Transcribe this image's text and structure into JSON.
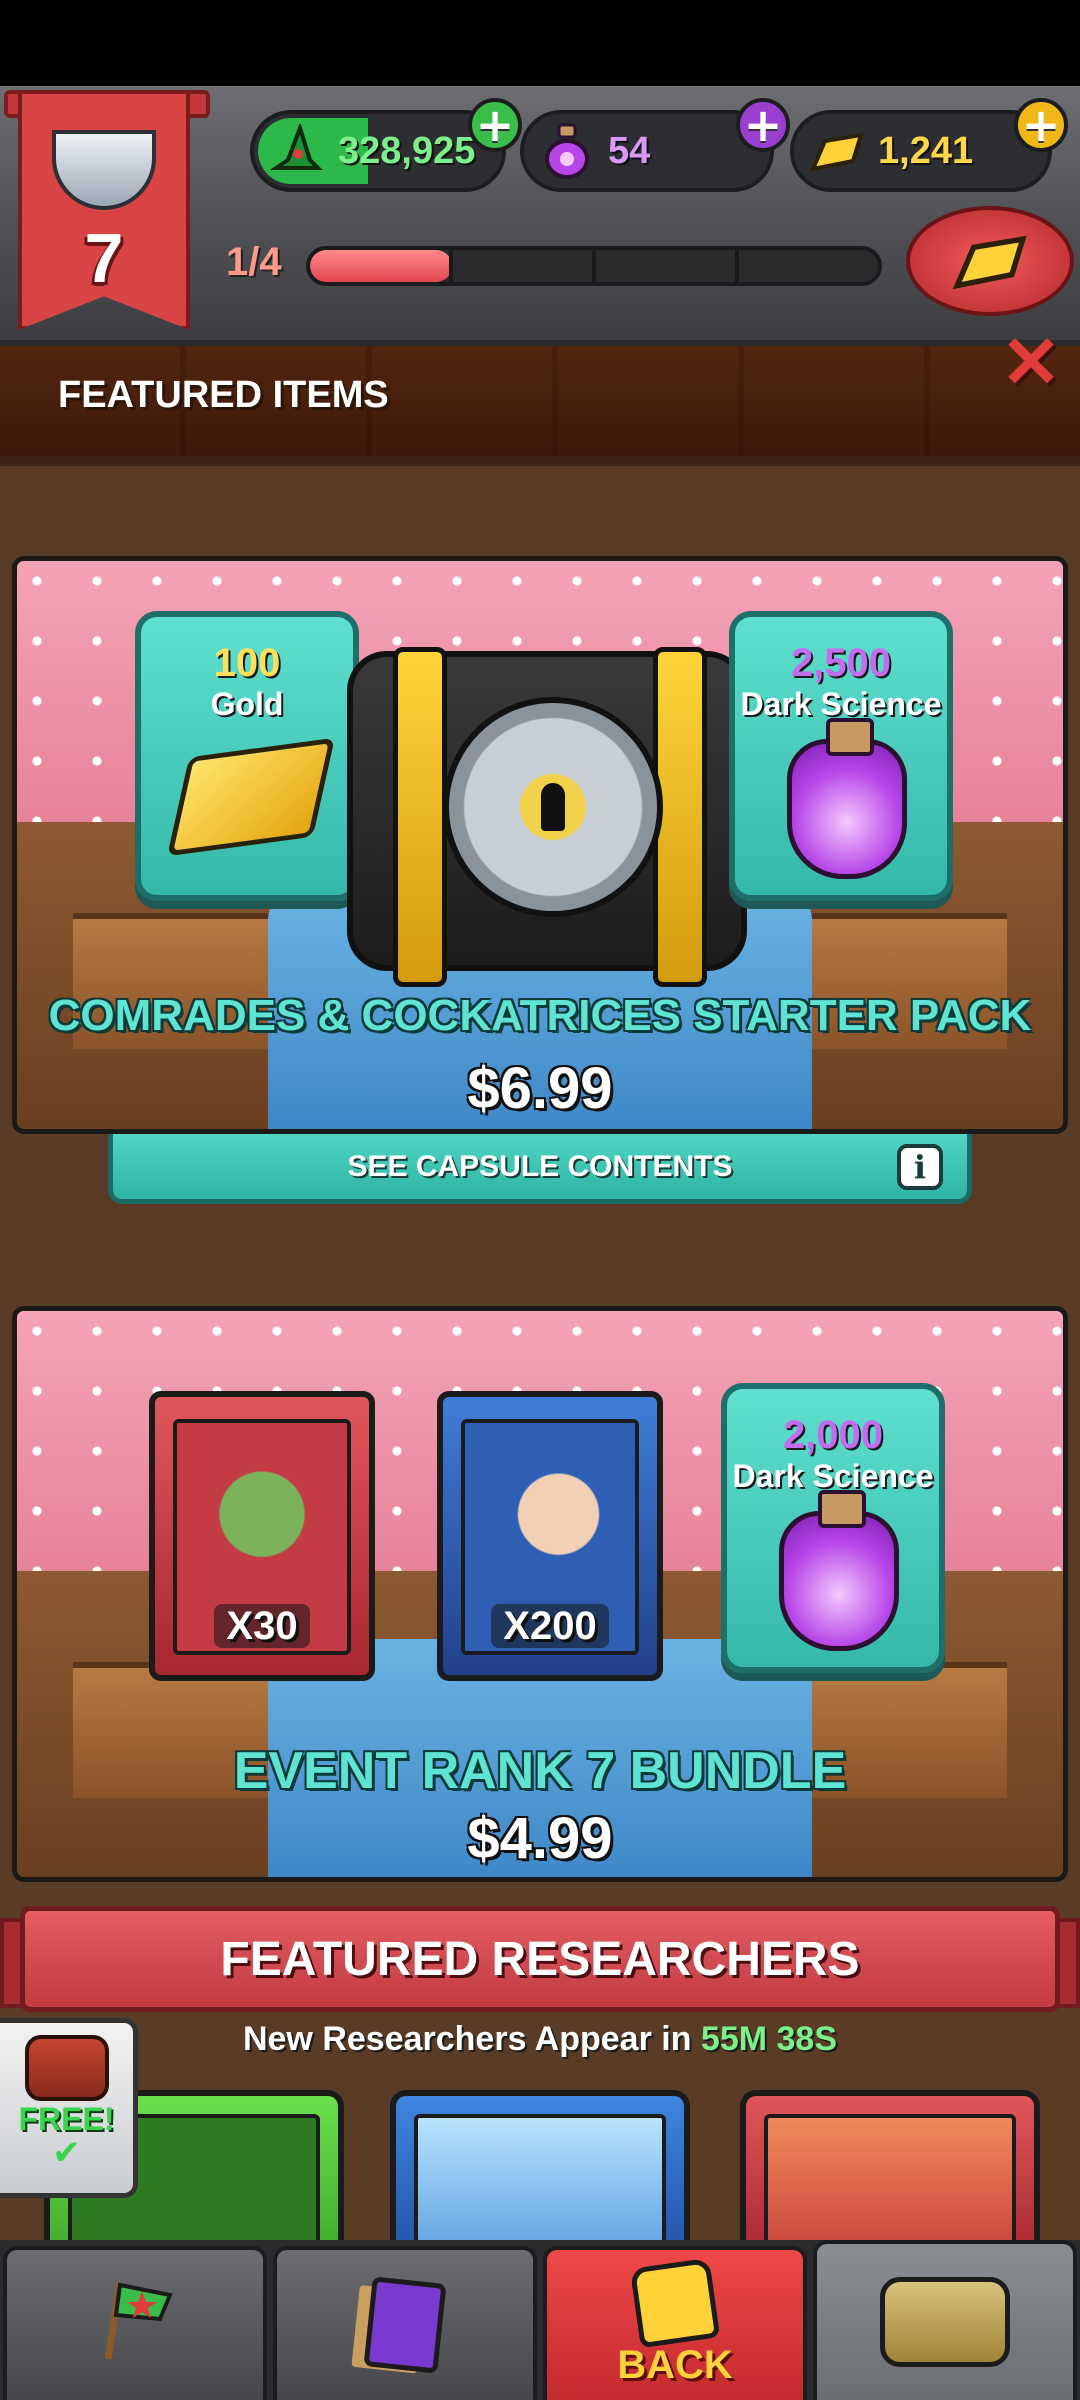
{
  "hud": {
    "rank": "7",
    "currencies": {
      "green": {
        "value": "328,925",
        "icon": "wizard-hat-icon",
        "color": "#2db84a"
      },
      "purple": {
        "value": "54",
        "icon": "dark-science-potion-icon",
        "color": "#9b3fd2"
      },
      "gold": {
        "value": "1,241",
        "icon": "gold-bar-icon",
        "color": "#f0b816"
      }
    },
    "progress": {
      "label": "1/4",
      "fraction": 0.25
    },
    "plus_symbol": "+",
    "close_symbol": "✕"
  },
  "featured": {
    "title": "FEATURED ITEMS",
    "offers": [
      {
        "tiles": [
          {
            "amount": "100",
            "name": "Gold",
            "icon": "gold-bar-icon"
          },
          {
            "amount": "2,500",
            "name": "Dark Science",
            "icon": "dark-science-potion-icon"
          }
        ],
        "centerpiece": "vault-capsule-icon",
        "name": "COMRADES & COCKATRICES STARTER PACK",
        "price": "$6.99",
        "capsule_button": "SEE CAPSULE CONTENTS",
        "info_symbol": "i"
      },
      {
        "cards": [
          {
            "count": "X30",
            "frame_color": "#d94545"
          },
          {
            "count": "X200",
            "frame_color": "#3f7ed8"
          }
        ],
        "tiles": [
          {
            "amount": "2,000",
            "name": "Dark Science",
            "icon": "dark-science-potion-icon"
          }
        ],
        "name": "EVENT RANK 7 BUNDLE",
        "price": "$4.99"
      }
    ]
  },
  "researchers": {
    "title": "FEATURED RESEARCHERS",
    "timer_prefix": "New Researchers Appear in",
    "timer_value": "55M 38S",
    "free_label": "FREE!"
  },
  "nav": {
    "tabs": [
      {
        "icon": "red-star-flag-icon"
      },
      {
        "icon": "cards-icon"
      },
      {
        "icon": "fist-icon",
        "label": "BACK"
      },
      {
        "icon": "treasure-chest-icon"
      }
    ]
  }
}
